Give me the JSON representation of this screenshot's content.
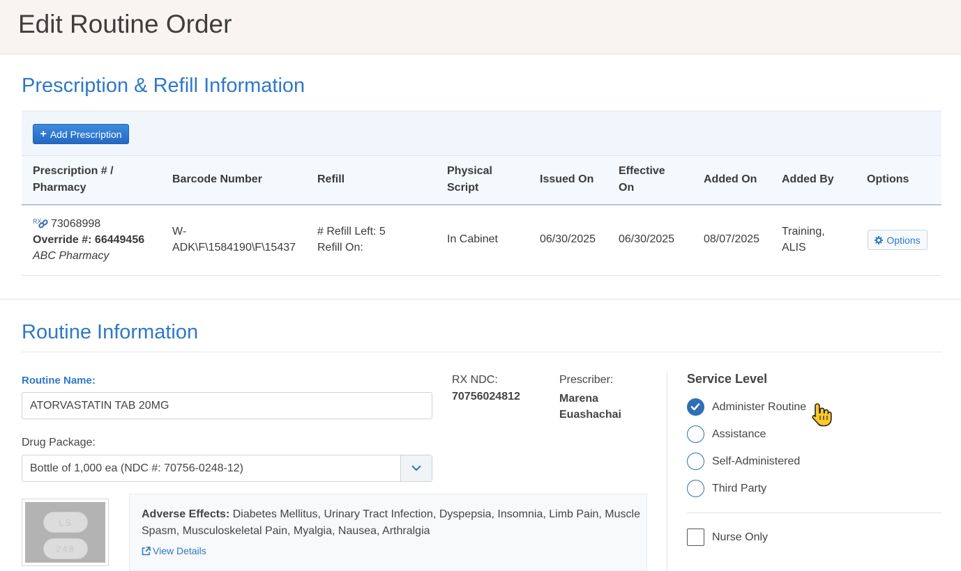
{
  "page": {
    "title": "Edit Routine Order"
  },
  "prescription": {
    "section_title": "Prescription & Refill Information",
    "add_button": "Add Prescription",
    "headers": {
      "rx_line1": "Prescription # /",
      "rx_line2": "Pharmacy",
      "barcode": "Barcode Number",
      "refill": "Refill",
      "physical_line1": "Physical",
      "physical_line2": "Script",
      "issued": "Issued On",
      "effective_line1": "Effective",
      "effective_line2": "On",
      "added_on": "Added On",
      "added_by": "Added By",
      "options": "Options"
    },
    "row": {
      "rx_badge": "RX",
      "rx_number": "73068998",
      "override": "Override #: 66449456",
      "pharmacy": "ABC Pharmacy",
      "barcode_line1": "W-",
      "barcode_line2": "ADK\\F\\1584190\\F\\15437",
      "refill_left": "# Refill Left: 5",
      "refill_on": "Refill On:",
      "physical_script": "In Cabinet",
      "issued_on": "06/30/2025",
      "effective_on": "06/30/2025",
      "added_on": "08/07/2025",
      "added_by_line1": "Training,",
      "added_by_line2": "ALIS",
      "options_button": "Options"
    }
  },
  "routine": {
    "section_title": "Routine Information",
    "name_label": "Routine Name:",
    "name_value": "ATORVASTATIN TAB 20MG",
    "ndc_label": "RX NDC:",
    "ndc_value": "70756024812",
    "prescriber_label": "Prescriber:",
    "prescriber_line1": "Marena",
    "prescriber_line2": "Euashachai",
    "package_label": "Drug Package:",
    "package_value": "Bottle of 1,000 ea (NDC #: 70756-0248-12)",
    "pill_text_top": "LS",
    "pill_text_bottom": "248",
    "adverse_label": "Adverse Effects:",
    "adverse_value": " Diabetes Mellitus, Urinary Tract Infection, Dyspepsia, Insomnia, Limb Pain, Muscle Spasm, Musculoskeletal Pain, Myalgia, Nausea, Arthralgia",
    "view_details": "View Details"
  },
  "service_level": {
    "title": "Service Level",
    "options": [
      {
        "label": "Administer Routine",
        "checked": true
      },
      {
        "label": "Assistance",
        "checked": false
      },
      {
        "label": "Self-Administered",
        "checked": false
      },
      {
        "label": "Third Party",
        "checked": false
      }
    ],
    "nurse_only": "Nurse Only"
  },
  "colors": {
    "accent": "#2e78c7",
    "header_bg": "#f9f3f1",
    "primary_button": "#2a72cf"
  }
}
